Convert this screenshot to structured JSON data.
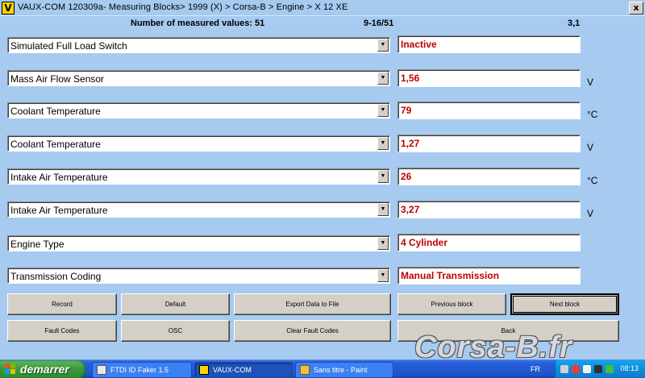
{
  "window": {
    "title": "VAUX-COM 120309a- Measuring Blocks> 1999 (X) > Corsa-B > Engine > X 12 XE",
    "app_icon_letter": "V",
    "close_glyph": "x"
  },
  "info": {
    "measured_count": "Number of measured values: 51",
    "range": "9-16/51",
    "block": "3,1"
  },
  "rows": [
    {
      "label": "Simulated Full Load Switch",
      "value": "Inactive",
      "unit": ""
    },
    {
      "label": "Mass Air Flow Sensor",
      "value": "1,56",
      "unit": "V"
    },
    {
      "label": "Coolant Temperature",
      "value": "79",
      "unit": "°C"
    },
    {
      "label": "Coolant Temperature",
      "value": "1,27",
      "unit": "V"
    },
    {
      "label": "Intake Air Temperature",
      "value": "26",
      "unit": "°C"
    },
    {
      "label": "Intake Air Temperature",
      "value": "3,27",
      "unit": "V"
    },
    {
      "label": "Engine Type",
      "value": "4 Cylinder",
      "unit": ""
    },
    {
      "label": "Transmission Coding",
      "value": "Manual Transmission",
      "unit": ""
    }
  ],
  "buttons": {
    "record": "Record",
    "default": "Default",
    "export": "Export Data to File",
    "previous": "Previous block",
    "next": "Next block",
    "fault_codes": "Fault Codes",
    "osc": "OSC",
    "clear_fault_codes": "Clear Fault Codes",
    "back": "Back"
  },
  "taskbar": {
    "start_label": "demarrer",
    "tasks": [
      {
        "label": "FTDI ID Faker 1.5",
        "icon": "ftdi-app-icon"
      },
      {
        "label": "VAUX-COM",
        "icon": "vauxcom-app-icon"
      },
      {
        "label": "Sans titre - Paint",
        "icon": "paint-app-icon"
      }
    ],
    "language": "FR",
    "clock": "08:13"
  },
  "watermark": "Corsa-B.fr",
  "colors": {
    "window_bg": "#a6caf0",
    "value_text": "#c00000",
    "taskbar": "#245edb",
    "start_button": "#3c9a3c"
  }
}
